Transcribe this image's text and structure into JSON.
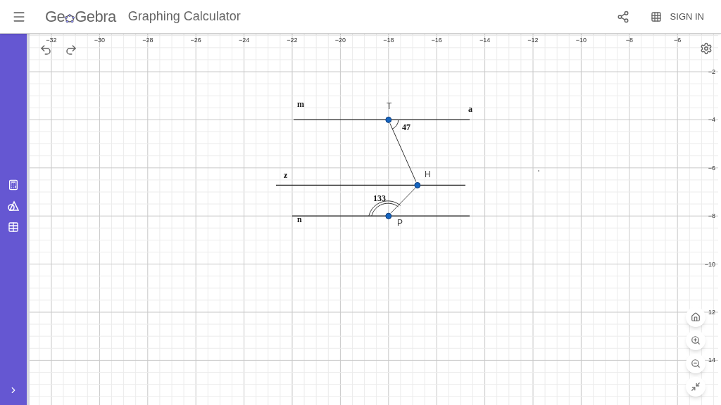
{
  "header": {
    "logo_start": "Ge",
    "logo_end": "Gebra",
    "title": "Graphing Calculator",
    "sign_in": "SIGN IN"
  },
  "graphics": {
    "x_ticks": [
      "−32",
      "−30",
      "−28",
      "−26",
      "−24",
      "−22",
      "−20",
      "−18",
      "−16",
      "−14",
      "−12",
      "−10",
      "−8",
      "−6"
    ],
    "y_ticks": [
      "−2",
      "−4",
      "−6",
      "−8",
      "−10",
      "12",
      "14"
    ],
    "line_labels": [
      "m",
      "a",
      "z",
      "n"
    ],
    "points": [
      "T",
      "H",
      "P"
    ],
    "angles": [
      "47",
      "133"
    ]
  }
}
